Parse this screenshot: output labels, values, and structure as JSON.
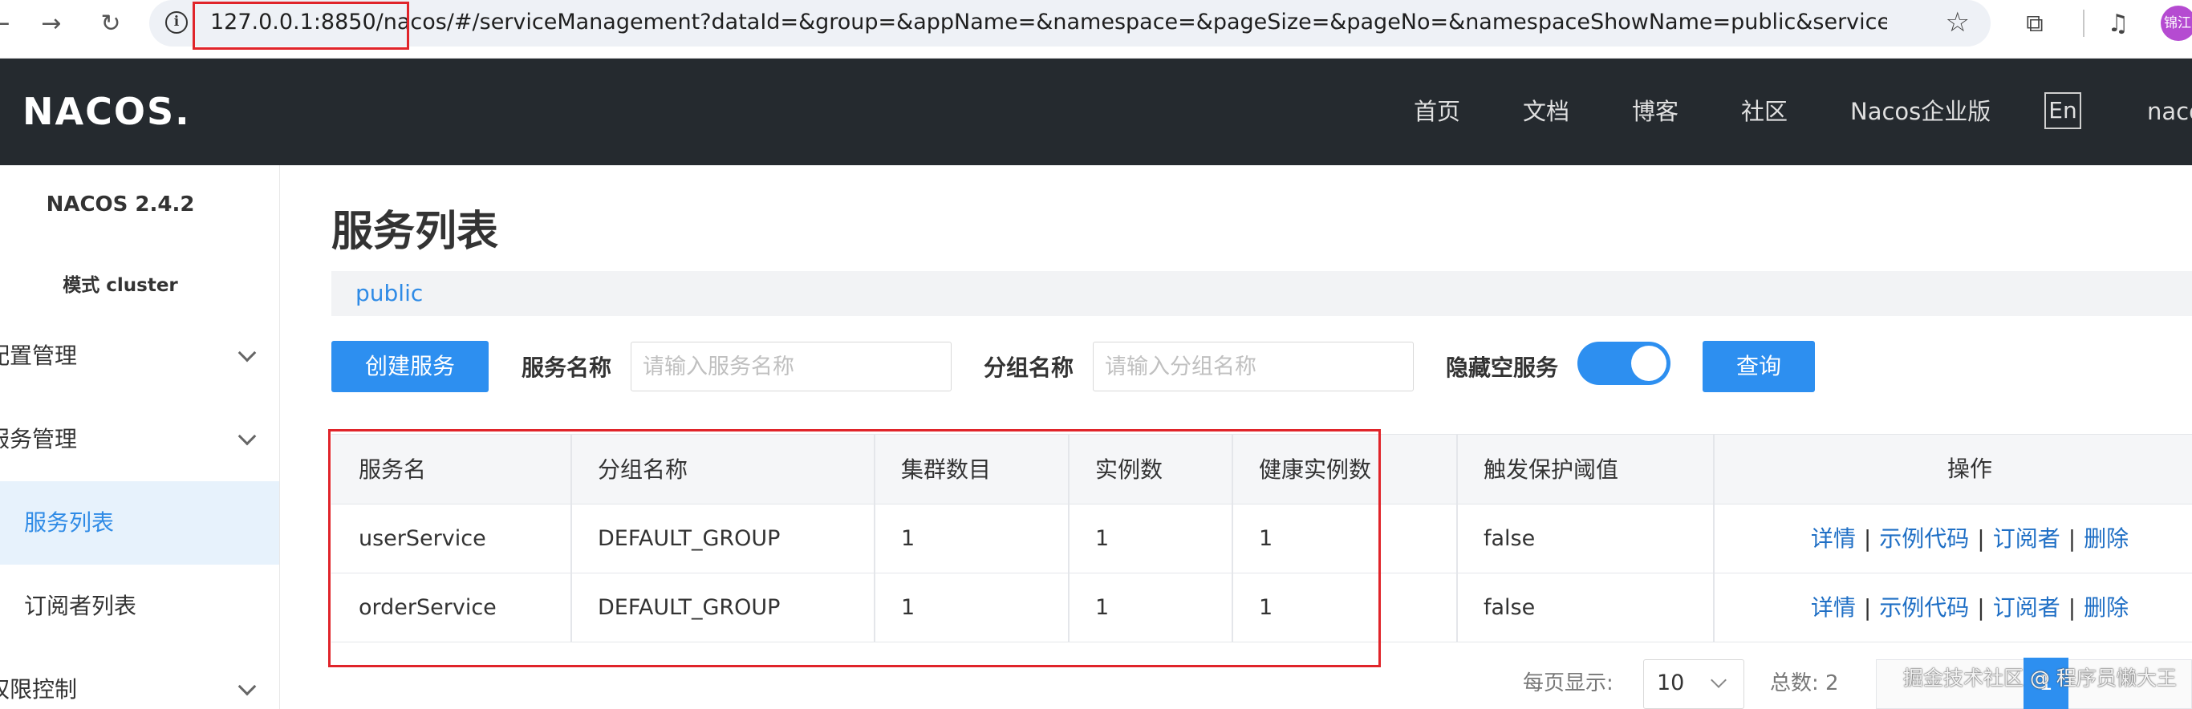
{
  "browser": {
    "url": "127.0.0.1:8850/nacos/#/serviceManagement?dataId=&group=&appName=&namespace=&pageSize=&pageNo=&namespaceShowName=public&serviceNameP…",
    "back_icon": "back-arrow-icon",
    "forward_icon": "forward-arrow-icon",
    "reload_icon": "reload-icon",
    "info_icon": "info-icon",
    "star_icon": "star-icon",
    "avatar_text": "锦江"
  },
  "header": {
    "logo": "NACOS.",
    "nav": [
      "首页",
      "文档",
      "博客",
      "社区",
      "Nacos企业版"
    ],
    "lang": "En",
    "user": "nacos"
  },
  "sidebar": {
    "version": "NACOS 2.4.2",
    "mode": "模式  cluster",
    "config_management": "配置管理",
    "service_management": "服务管理",
    "service_list": "服务列表",
    "subscriber_list": "订阅者列表",
    "auth_control": "权限控制"
  },
  "main": {
    "title": "服务列表",
    "namespace": "public",
    "create_button": "创建服务",
    "service_name_label": "服务名称",
    "service_name_placeholder": "请输入服务名称",
    "group_name_label": "分组名称",
    "group_name_placeholder": "请输入分组名称",
    "hide_empty_label": "隐藏空服务",
    "hide_empty_on": true,
    "query_button": "查询"
  },
  "table": {
    "columns": [
      "服务名",
      "分组名称",
      "集群数目",
      "实例数",
      "健康实例数",
      "触发保护阈值",
      "操作"
    ],
    "rows": [
      [
        "userService",
        "DEFAULT_GROUP",
        "1",
        "1",
        "1",
        "false"
      ],
      [
        "orderService",
        "DEFAULT_GROUP",
        "1",
        "1",
        "1",
        "false"
      ]
    ],
    "ops": [
      "详情",
      "示例代码",
      "订阅者",
      "删除"
    ],
    "op_separator": "|"
  },
  "pagination": {
    "page_size_label": "每页显示:",
    "page_size": "10",
    "total_label": "总数: 2",
    "current_page": "1"
  },
  "watermark": "掘金技术社区 @ 程序员懒大王",
  "colors": {
    "accent": "#2d8ff0",
    "header_bg": "#252a2f",
    "link": "#1f6fc5",
    "highlight": "#e0242a"
  }
}
